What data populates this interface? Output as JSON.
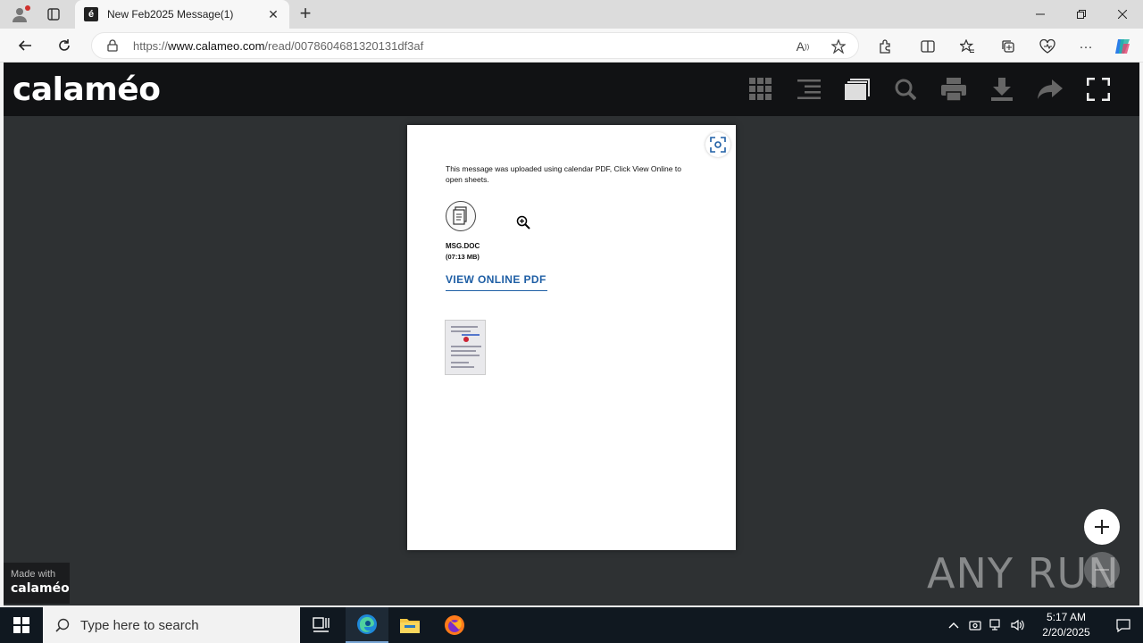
{
  "browser": {
    "tab_title": "New Feb2025 Message(1)",
    "favicon_glyph": "é",
    "url_prefix": "https://",
    "url_host": "www.calameo.com",
    "url_path": "/read/0078604681320131df3af"
  },
  "app": {
    "logo": "calaméo",
    "toolbar_icons": [
      "grid-icon",
      "list-icon",
      "library-icon",
      "search-icon",
      "print-icon",
      "download-icon",
      "share-icon",
      "fullscreen-icon"
    ]
  },
  "page": {
    "message": "This message was uploaded using calendar PDF, Click View Online to open sheets.",
    "file_name": "MSG.DOC",
    "file_size": "(07:13 MB)",
    "link_label": "VIEW ONLINE PDF"
  },
  "badge": {
    "made_with": "Made with",
    "brand": "calaméo"
  },
  "watermark": "ANY RUN",
  "taskbar": {
    "search_placeholder": "Type here to search",
    "time": "5:17 AM",
    "date": "2/20/2025"
  },
  "colors": {
    "link": "#1f5fa5",
    "viewer_bg": "#2e3133",
    "topbar_bg": "#111214"
  }
}
